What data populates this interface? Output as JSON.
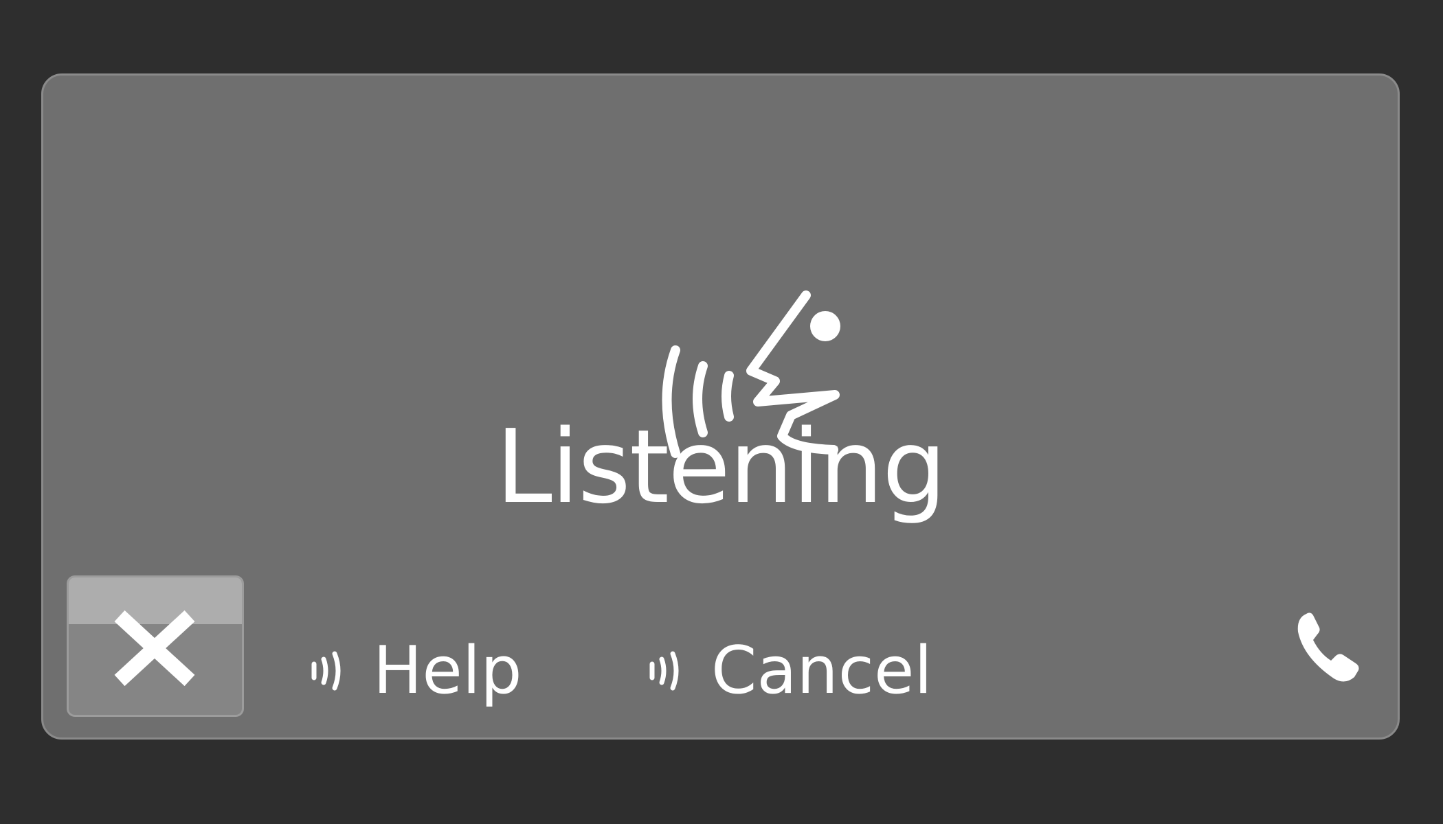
{
  "dialog": {
    "status_label": "Listening",
    "status_icon": "voice-listening-icon",
    "close_icon": "close-icon"
  },
  "commands": {
    "help_label": "Help",
    "cancel_label": "Cancel",
    "command_icon": "speech-waves-icon"
  },
  "phone": {
    "icon": "phone-icon"
  },
  "colors": {
    "background": "#2e2e2e",
    "panel": "#6f6f6f",
    "panel_border": "#8a8a8a",
    "text": "#ffffff",
    "close_button": "#858585"
  }
}
